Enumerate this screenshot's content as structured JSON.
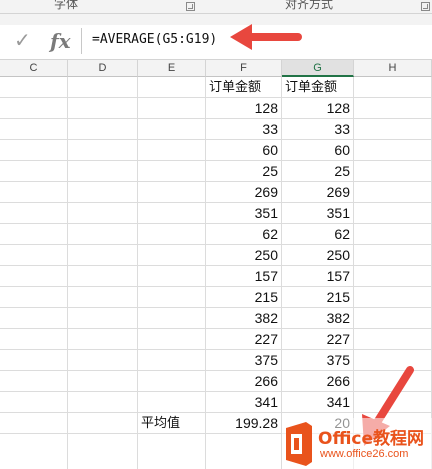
{
  "ribbon": {
    "groups": [
      {
        "label": "字体"
      },
      {
        "label": "对齐方式"
      }
    ]
  },
  "formula_bar": {
    "cancel_icon": "checkmark-icon",
    "function_label": "fx",
    "formula": "=AVERAGE(G5:G19)"
  },
  "columns": [
    "C",
    "D",
    "E",
    "F",
    "G",
    "H"
  ],
  "selected_column": "G",
  "table": {
    "header_f": "订单金额",
    "header_g": "订单金额",
    "rows": [
      {
        "f": "128",
        "g": "128"
      },
      {
        "f": "33",
        "g": "33"
      },
      {
        "f": "60",
        "g": "60"
      },
      {
        "f": "25",
        "g": "25"
      },
      {
        "f": "269",
        "g": "269"
      },
      {
        "f": "351",
        "g": "351"
      },
      {
        "f": "62",
        "g": "62"
      },
      {
        "f": "250",
        "g": "250"
      },
      {
        "f": "157",
        "g": "157"
      },
      {
        "f": "215",
        "g": "215"
      },
      {
        "f": "382",
        "g": "382"
      },
      {
        "f": "227",
        "g": "227"
      },
      {
        "f": "375",
        "g": "375"
      },
      {
        "f": "266",
        "g": "266"
      },
      {
        "f": "341",
        "g": "341"
      }
    ],
    "average_label": "平均值",
    "average_f": "199.28",
    "average_g": "20"
  },
  "watermark": {
    "title": "Office教程网",
    "url": "www.office26.com"
  },
  "colors": {
    "arrow": "#e8473e",
    "logo_orange": "#e9531c",
    "selected_col": "#217346"
  }
}
